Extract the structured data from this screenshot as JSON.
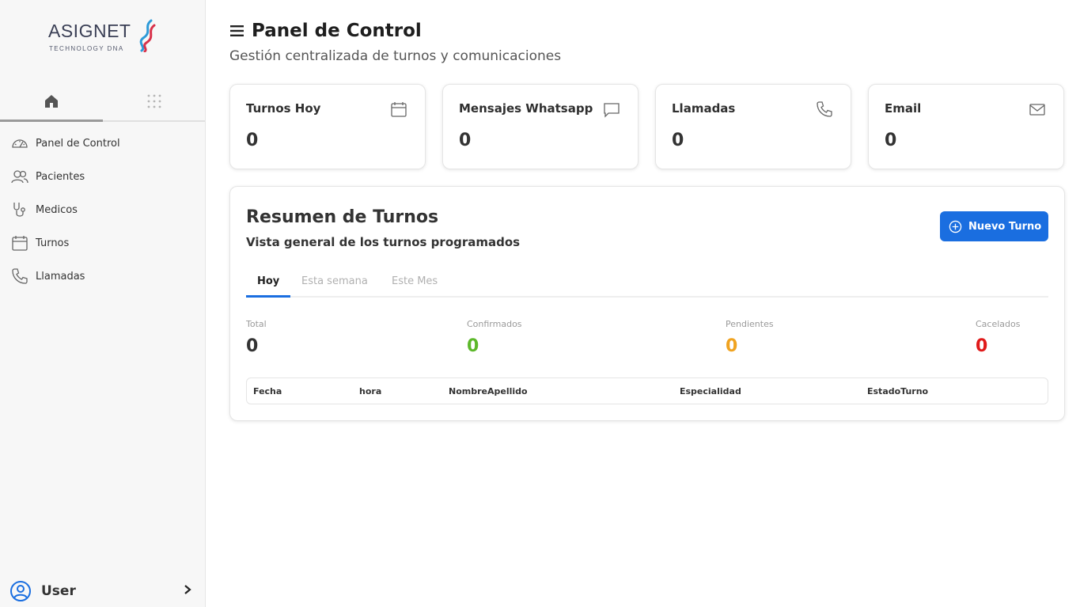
{
  "brand": {
    "name": "ASIGNET",
    "tagline": "TECHNOLOGY DNA"
  },
  "sidebar": {
    "tabs": [
      {
        "icon": "home-icon",
        "active": true
      },
      {
        "icon": "grid-dots-icon",
        "active": false
      }
    ],
    "items": [
      {
        "label": "Panel de Control",
        "icon": "gauge-icon"
      },
      {
        "label": "Pacientes",
        "icon": "users-icon"
      },
      {
        "label": "Medicos",
        "icon": "stethoscope-icon"
      },
      {
        "label": "Turnos",
        "icon": "calendar-icon"
      },
      {
        "label": "Llamadas",
        "icon": "phone-icon"
      }
    ],
    "user": {
      "name": "User",
      "icon": "user-circle-icon"
    }
  },
  "header": {
    "title": "Panel de Control",
    "subtitle": "Gestión centralizada de turnos y comunicaciones"
  },
  "cards": [
    {
      "label": "Turnos Hoy",
      "value": "0",
      "icon": "calendar-icon"
    },
    {
      "label": "Mensajes Whatsapp",
      "value": "0",
      "icon": "message-icon"
    },
    {
      "label": "Llamadas",
      "value": "0",
      "icon": "phone-icon"
    },
    {
      "label": "Email",
      "value": "0",
      "icon": "mail-icon"
    }
  ],
  "summary": {
    "title": "Resumen de Turnos",
    "subtitle": "Vista general de los turnos programados",
    "new_button": "Nuevo Turno",
    "tabs": [
      "Hoy",
      "Esta semana",
      "Este Mes"
    ],
    "active_tab": "Hoy",
    "stats": [
      {
        "label": "Total",
        "value": "0",
        "color": "#333333"
      },
      {
        "label": "Confirmados",
        "value": "0",
        "color": "#5cb82a"
      },
      {
        "label": "Pendientes",
        "value": "0",
        "color": "#f0a320"
      },
      {
        "label": "Cacelados",
        "value": "0",
        "color": "#e01a1a"
      }
    ],
    "table_headers": [
      "Fecha",
      "hora",
      "NombreApellido",
      "Especialidad",
      "EstadoTurno"
    ]
  },
  "colors": {
    "accent": "#1a6ee0",
    "sidebar_bg": "#f7f7f7"
  }
}
